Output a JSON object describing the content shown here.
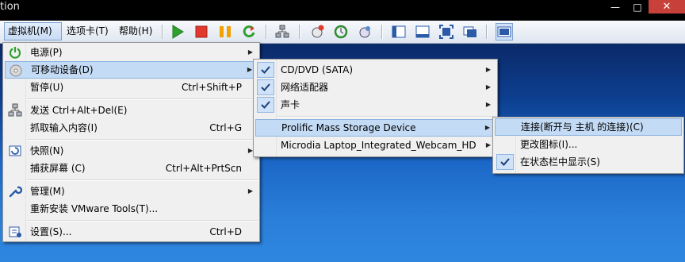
{
  "window": {
    "title_fragment": "tion"
  },
  "menubar": {
    "vm": "虚拟机(M)",
    "tabs": "选项卡(T)",
    "help": "帮助(H)"
  },
  "main_menu": {
    "power": "电源(P)",
    "removable": "可移动设备(D)",
    "pause": "暂停(U)",
    "pause_sc": "Ctrl+Shift+P",
    "send_cad": "发送 Ctrl+Alt+Del(E)",
    "grab": "抓取输入内容(I)",
    "grab_sc": "Ctrl+G",
    "snapshot": "快照(N)",
    "capture": "捕获屏幕 (C)",
    "capture_sc": "Ctrl+Alt+PrtScn",
    "manage": "管理(M)",
    "reinstall": "重新安装 VMware Tools(T)...",
    "settings": "设置(S)...",
    "settings_sc": "Ctrl+D"
  },
  "devices_menu": {
    "cddvd": "CD/DVD (SATA)",
    "network": "网络适配器",
    "sound": "声卡",
    "prolific": "Prolific Mass Storage Device",
    "webcam": "Microdia Laptop_Integrated_Webcam_HD"
  },
  "prolific_menu": {
    "connect": "连接(断开与 主机 的连接)(C)",
    "change_icon": "更改图标(I)...",
    "show_status": "在状态栏中显示(S)"
  },
  "colors": {
    "accent_green": "#2ea02e",
    "accent_red": "#e03a2e",
    "accent_orange": "#f2a100",
    "highlight": "#c3dbf5"
  }
}
